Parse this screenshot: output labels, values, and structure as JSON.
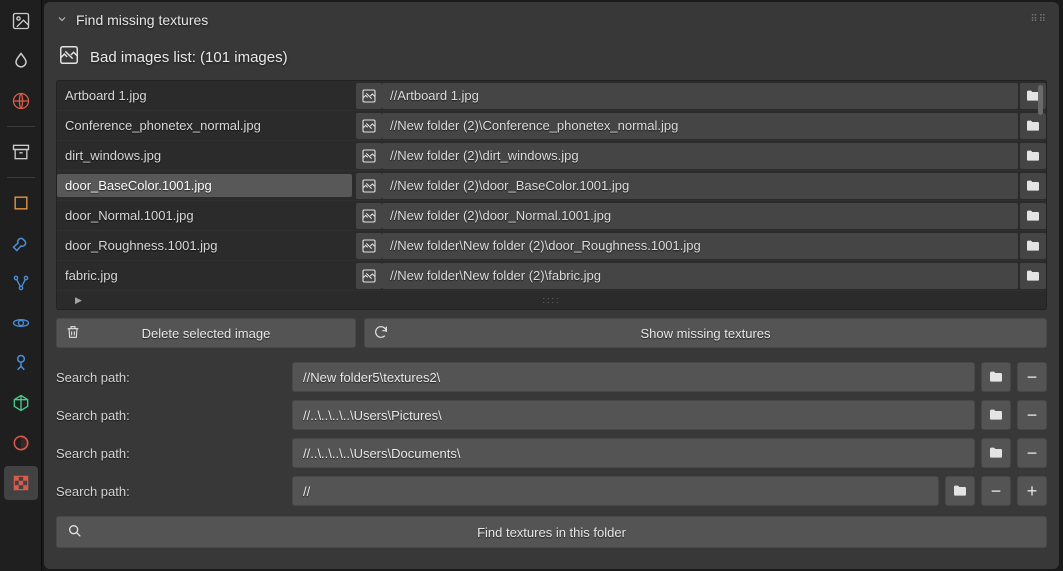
{
  "panel": {
    "title": "Find missing textures"
  },
  "bad_list": {
    "heading": "Bad images list: (101 images)",
    "rows": [
      {
        "name": "Artboard 1.jpg",
        "path": "//Artboard 1.jpg",
        "selected": false
      },
      {
        "name": "Conference_phonetex_normal.jpg",
        "path": "//New folder (2)\\Conference_phonetex_normal.jpg",
        "selected": false
      },
      {
        "name": "dirt_windows.jpg",
        "path": "//New folder (2)\\dirt_windows.jpg",
        "selected": false
      },
      {
        "name": "door_BaseColor.1001.jpg",
        "path": "//New folder (2)\\door_BaseColor.1001.jpg",
        "selected": true
      },
      {
        "name": "door_Normal.1001.jpg",
        "path": "//New folder (2)\\door_Normal.1001.jpg",
        "selected": false
      },
      {
        "name": "door_Roughness.1001.jpg",
        "path": "//New folder\\New folder (2)\\door_Roughness.1001.jpg",
        "selected": false
      },
      {
        "name": "fabric.jpg",
        "path": "//New folder\\New folder (2)\\fabric.jpg",
        "selected": false
      }
    ]
  },
  "buttons": {
    "delete": "Delete selected image",
    "show": "Show missing textures",
    "find": "Find textures in this folder"
  },
  "search_paths": {
    "label": "Search path:",
    "rows": [
      {
        "value": "//New folder5\\textures2\\",
        "buttons": [
          "folder",
          "minus"
        ]
      },
      {
        "value": "//..\\..\\..\\..\\Users\\Pictures\\",
        "buttons": [
          "folder",
          "minus"
        ]
      },
      {
        "value": "//..\\..\\..\\..\\Users\\Documents\\",
        "buttons": [
          "folder",
          "minus"
        ]
      },
      {
        "value": "//",
        "buttons": [
          "folder",
          "minus",
          "plus"
        ]
      }
    ]
  }
}
